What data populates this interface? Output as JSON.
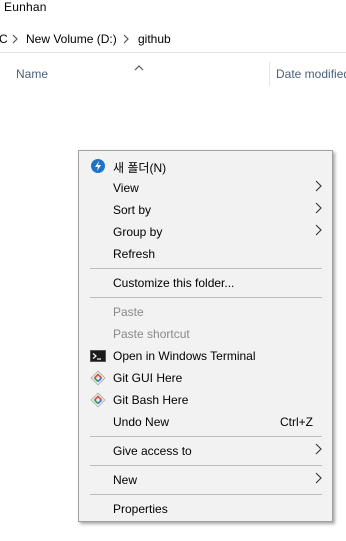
{
  "top": {
    "user": "Eunhan"
  },
  "address": {
    "partial": "C",
    "volume": "New Volume (D:)",
    "folder": "github"
  },
  "columns": {
    "name": "Name",
    "date": "Date modified"
  },
  "menu": {
    "new_folder": "새 폴더(N)",
    "view": "View",
    "sort_by": "Sort by",
    "group_by": "Group by",
    "refresh": "Refresh",
    "customize": "Customize this folder...",
    "paste": "Paste",
    "paste_shortcut": "Paste shortcut",
    "open_terminal": "Open in Windows Terminal",
    "git_gui": "Git GUI Here",
    "git_bash": "Git Bash Here",
    "undo_new": "Undo New",
    "undo_shortcut": "Ctrl+Z",
    "give_access": "Give access to",
    "new": "New",
    "properties": "Properties"
  },
  "colors": {
    "menu_bg": "#f2f2f2",
    "disabled_text": "#8a8a8a",
    "header_text": "#4c607a",
    "new_folder_icon": "#1e73c8"
  }
}
